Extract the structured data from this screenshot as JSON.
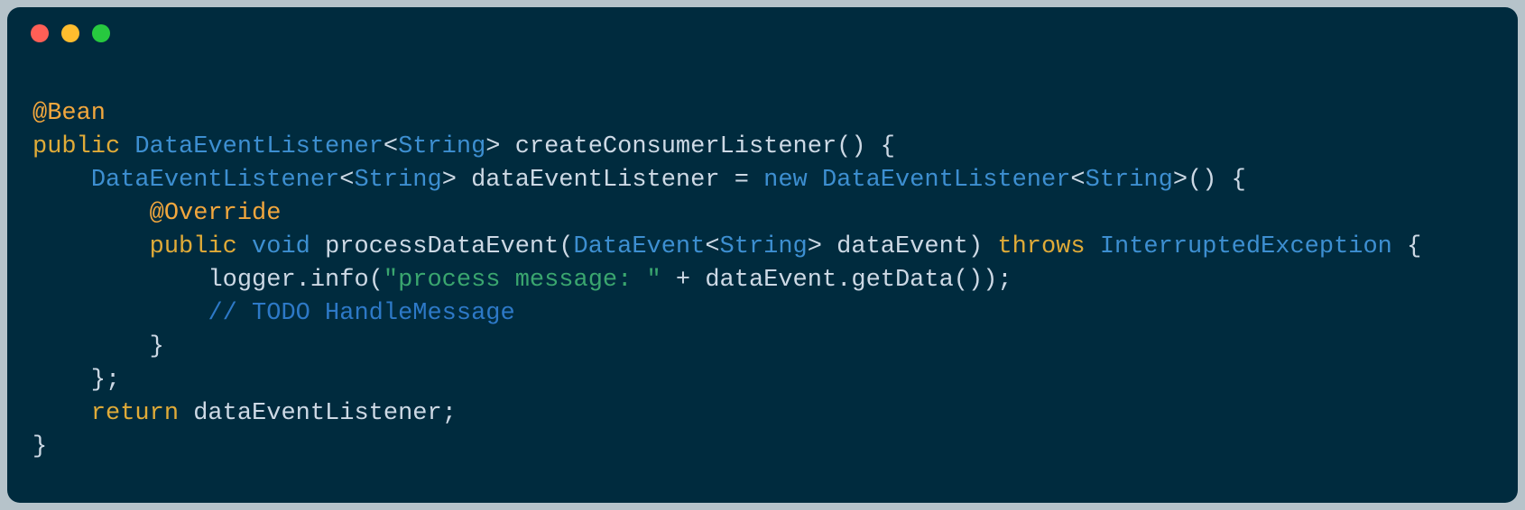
{
  "window": {
    "dots": [
      "close",
      "minimize",
      "zoom"
    ]
  },
  "code": {
    "l1": {
      "annot": "@Bean"
    },
    "l2": {
      "kw_public": "public",
      "type": "DataEventListener",
      "gen_open": "<",
      "gen_type": "String",
      "gen_close": ">",
      "method": "createConsumerListener",
      "tail": "() {"
    },
    "l3": {
      "indent": "    ",
      "type1": "DataEventListener",
      "gen1_open": "<",
      "gen1_type": "String",
      "gen1_close": ">",
      "sp1": " ",
      "var": "dataEventListener",
      "eq": " = ",
      "kw_new": "new",
      "sp2": " ",
      "type2": "DataEventListener",
      "gen2_open": "<",
      "gen2_type": "String",
      "gen2_close": ">",
      "tail": "() {"
    },
    "l4": {
      "indent": "        ",
      "annot": "@Override"
    },
    "l5": {
      "indent": "        ",
      "kw_public": "public",
      "sp1": " ",
      "kw_void": "void",
      "sp2": " ",
      "method": "processDataEvent",
      "paren_open": "(",
      "ptype": "DataEvent",
      "gen_open": "<",
      "gen_type": "String",
      "gen_close": ">",
      "sp3": " ",
      "pname": "dataEvent",
      "paren_close": ")",
      "sp4": " ",
      "kw_throws": "throws",
      "sp5": " ",
      "exc": "InterruptedException",
      "tail": " {"
    },
    "l6": {
      "indent": "            ",
      "obj": "logger",
      "dot": ".",
      "call": "info",
      "paren_open": "(",
      "str": "\"process message: \"",
      "plus": " + ",
      "arg": "dataEvent",
      "dot2": ".",
      "call2": "getData",
      "tail": "());"
    },
    "l7": {
      "indent": "            ",
      "comment": "// TODO HandleMessage"
    },
    "l8": {
      "text": "        }"
    },
    "l9": {
      "text": "    };"
    },
    "l10": {
      "indent": "    ",
      "kw_return": "return",
      "sp": " ",
      "var": "dataEventListener",
      "tail": ";"
    },
    "l11": {
      "text": "}"
    }
  }
}
